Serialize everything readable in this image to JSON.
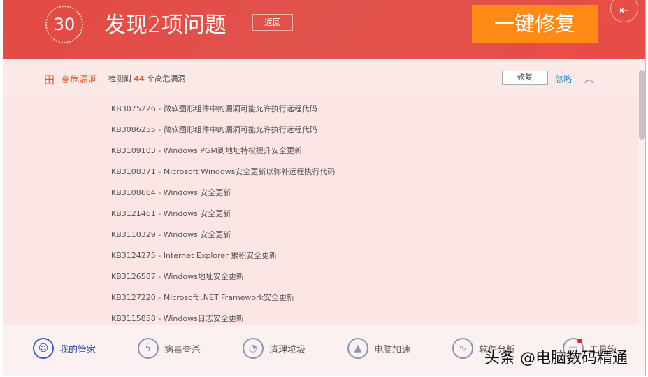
{
  "header": {
    "score": "30",
    "title": "发现2项问题",
    "back_label": "返回",
    "fix_all_label": "一键修复"
  },
  "section": {
    "name": "高危漏洞",
    "detected_prefix": "检测到",
    "count": "44",
    "detected_suffix": "个高危漏洞",
    "fix_label": "修复",
    "ignore_label": "忽略"
  },
  "items": [
    "KB3075226 - 微软图形组件中的漏洞可能允许执行远程代码",
    "KB3086255 - 微软图形组件中的漏洞可能允许执行远程代码",
    "KB3109103 - Windows PGM到地址特权提升安全更新",
    "KB3108371 - Microsoft Windows安全更新以弥补远程执行代码",
    "KB3108664 - Windows 安全更新",
    "KB3121461 - Windows 安全更新",
    "KB3110329 - Windows 安全更新",
    "KB3124275 - Internet Explorer 累积安全更新",
    "KB3126587 - Windows地址安全更新",
    "KB3127220 - Microsoft .NET Framework安全更新",
    "KB3115858 - Windows日志安全更新"
  ],
  "nav": [
    "我的管家",
    "病毒查杀",
    "清理垃圾",
    "电脑加速",
    "软件分析",
    "工具箱"
  ],
  "watermark": "头条 @电脑数码精通"
}
